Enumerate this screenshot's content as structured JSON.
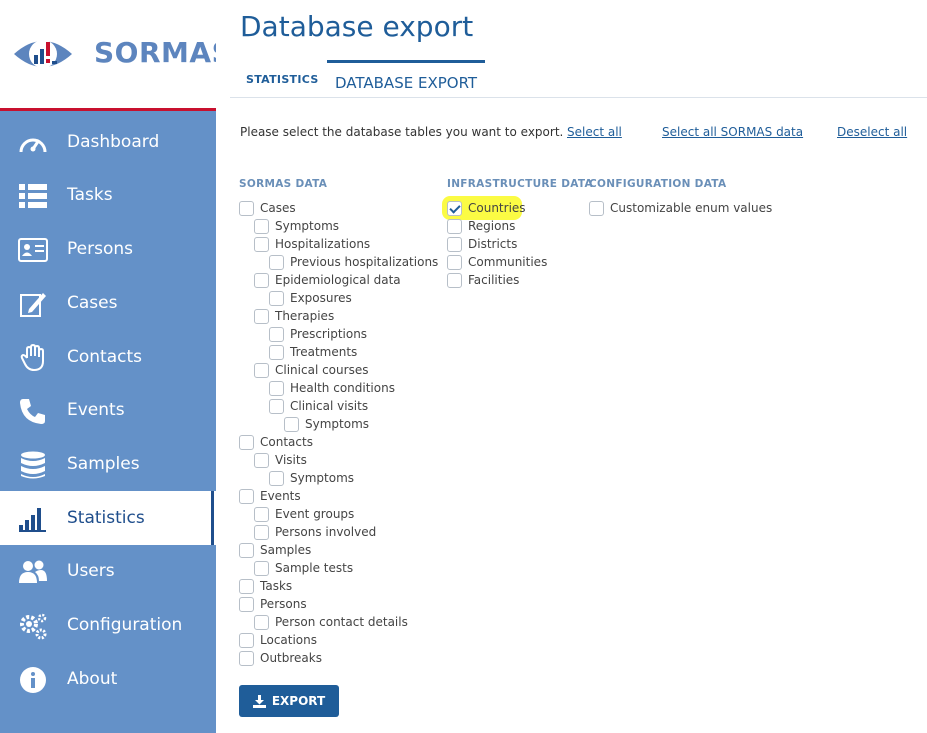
{
  "app": {
    "name": "SORMAS"
  },
  "colors": {
    "sidebar": "#6491c8",
    "accent": "#1f5d99",
    "highlight": "#fbfb3a",
    "logo_red_bar": "#c8102e"
  },
  "sidebar": {
    "items": [
      {
        "label": "Dashboard",
        "icon": "dashboard-gauge-icon"
      },
      {
        "label": "Tasks",
        "icon": "tasks-list-icon"
      },
      {
        "label": "Persons",
        "icon": "person-card-icon"
      },
      {
        "label": "Cases",
        "icon": "edit-pencil-icon"
      },
      {
        "label": "Contacts",
        "icon": "hand-icon"
      },
      {
        "label": "Events",
        "icon": "phone-icon"
      },
      {
        "label": "Samples",
        "icon": "database-icon"
      },
      {
        "label": "Statistics",
        "icon": "bar-chart-icon",
        "active": true
      },
      {
        "label": "Users",
        "icon": "users-icon"
      },
      {
        "label": "Configuration",
        "icon": "gears-icon"
      },
      {
        "label": "About",
        "icon": "info-icon"
      }
    ]
  },
  "main": {
    "title": "Database export",
    "tabs": [
      {
        "label": "STATISTICS"
      },
      {
        "label": "DATABASE EXPORT",
        "active": true
      }
    ],
    "instructions": "Please select the database tables you want to export.",
    "links": {
      "select_all": "Select all",
      "select_all_sormas": "Select all SORMAS data",
      "deselect_all": "Deselect all"
    },
    "columns": {
      "sormas": {
        "header": "SORMAS DATA",
        "items": [
          {
            "label": "Cases",
            "level": 0,
            "checked": false
          },
          {
            "label": "Symptoms",
            "level": 1,
            "checked": false
          },
          {
            "label": "Hospitalizations",
            "level": 1,
            "checked": false
          },
          {
            "label": "Previous hospitalizations",
            "level": 2,
            "checked": false
          },
          {
            "label": "Epidemiological data",
            "level": 1,
            "checked": false
          },
          {
            "label": "Exposures",
            "level": 2,
            "checked": false
          },
          {
            "label": "Therapies",
            "level": 1,
            "checked": false
          },
          {
            "label": "Prescriptions",
            "level": 2,
            "checked": false
          },
          {
            "label": "Treatments",
            "level": 2,
            "checked": false
          },
          {
            "label": "Clinical courses",
            "level": 1,
            "checked": false
          },
          {
            "label": "Health conditions",
            "level": 2,
            "checked": false
          },
          {
            "label": "Clinical visits",
            "level": 2,
            "checked": false
          },
          {
            "label": "Symptoms",
            "level": 3,
            "checked": false
          },
          {
            "label": "Contacts",
            "level": 0,
            "checked": false
          },
          {
            "label": "Visits",
            "level": 1,
            "checked": false
          },
          {
            "label": "Symptoms",
            "level": 2,
            "checked": false
          },
          {
            "label": "Events",
            "level": 0,
            "checked": false
          },
          {
            "label": "Event groups",
            "level": 1,
            "checked": false
          },
          {
            "label": "Persons involved",
            "level": 1,
            "checked": false
          },
          {
            "label": "Samples",
            "level": 0,
            "checked": false
          },
          {
            "label": "Sample tests",
            "level": 1,
            "checked": false
          },
          {
            "label": "Tasks",
            "level": 0,
            "checked": false
          },
          {
            "label": "Persons",
            "level": 0,
            "checked": false
          },
          {
            "label": "Person contact details",
            "level": 1,
            "checked": false
          },
          {
            "label": "Locations",
            "level": 0,
            "checked": false
          },
          {
            "label": "Outbreaks",
            "level": 0,
            "checked": false
          }
        ]
      },
      "infrastructure": {
        "header": "INFRASTRUCTURE DATA",
        "items": [
          {
            "label": "Countries",
            "level": 0,
            "checked": true
          },
          {
            "label": "Regions",
            "level": 0,
            "checked": false
          },
          {
            "label": "Districts",
            "level": 0,
            "checked": false
          },
          {
            "label": "Communities",
            "level": 0,
            "checked": false
          },
          {
            "label": "Facilities",
            "level": 0,
            "checked": false
          }
        ]
      },
      "configuration": {
        "header": "CONFIGURATION DATA",
        "items": [
          {
            "label": "Customizable enum values",
            "level": 0,
            "checked": false
          }
        ]
      }
    },
    "export_button": {
      "label": "EXPORT",
      "icon": "download-icon"
    }
  }
}
